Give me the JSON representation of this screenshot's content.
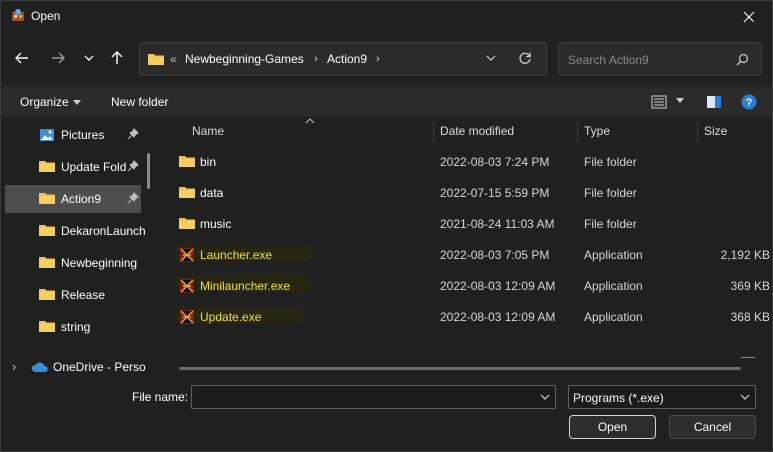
{
  "window": {
    "title": "Open",
    "close_glyph": "✕"
  },
  "nav": {
    "back": "back-arrow-icon",
    "forward": "forward-arrow-icon",
    "recent": "chevron-down-icon",
    "up": "up-arrow-icon"
  },
  "address": {
    "overflow": "«",
    "crumbs": [
      "Newbeginning-Games",
      "Action9"
    ],
    "separator": "›"
  },
  "search": {
    "placeholder": "Search Action9"
  },
  "commands": {
    "organize": "Organize",
    "new_folder": "New folder"
  },
  "sidebar": {
    "items": [
      {
        "label": "Pictures",
        "icon": "pictures-icon",
        "pinned": true,
        "selected": false
      },
      {
        "label": "Update Fold",
        "icon": "folder-icon",
        "pinned": true,
        "selected": false
      },
      {
        "label": "Action9",
        "icon": "folder-icon",
        "pinned": true,
        "selected": true
      },
      {
        "label": "DekaronLaunch",
        "icon": "folder-icon",
        "pinned": false,
        "selected": false
      },
      {
        "label": "Newbeginning",
        "icon": "folder-icon",
        "pinned": false,
        "selected": false
      },
      {
        "label": "Release",
        "icon": "folder-icon",
        "pinned": false,
        "selected": false
      },
      {
        "label": "string",
        "icon": "folder-icon",
        "pinned": false,
        "selected": false
      },
      {
        "label": "OneDrive - Perso",
        "icon": "onedrive-icon",
        "pinned": false,
        "selected": false
      }
    ],
    "expand_glyph": "›"
  },
  "columns": {
    "name": "Name",
    "date": "Date modified",
    "type": "Type",
    "size": "Size"
  },
  "files": [
    {
      "name": "bin",
      "date": "2022-08-03 7:24 PM",
      "type": "File folder",
      "size": "",
      "kind": "folder"
    },
    {
      "name": "data",
      "date": "2022-07-15 5:59 PM",
      "type": "File folder",
      "size": "",
      "kind": "folder"
    },
    {
      "name": "music",
      "date": "2021-08-24 11:03 AM",
      "type": "File folder",
      "size": "",
      "kind": "folder"
    },
    {
      "name": "Launcher.exe",
      "date": "2022-08-03 7:05 PM",
      "type": "Application",
      "size": "2,192 KB",
      "kind": "exe"
    },
    {
      "name": "Minilauncher.exe",
      "date": "2022-08-03 12:09 AM",
      "type": "Application",
      "size": "369 KB",
      "kind": "exe"
    },
    {
      "name": "Update.exe",
      "date": "2022-08-03 12:09 AM",
      "type": "Application",
      "size": "368 KB",
      "kind": "exe"
    }
  ],
  "bottom": {
    "file_name_label": "File name:",
    "file_name_value": "",
    "filter_value": "Programs (*.exe)",
    "open_label": "Open",
    "cancel_label": "Cancel"
  },
  "colors": {
    "background": "#202020",
    "toolbar": "#2b2b2b",
    "selected": "#4d4d4d",
    "folder": "#f2c14e",
    "exe_text": "#f4e01c",
    "help": "#2d7dd2"
  }
}
